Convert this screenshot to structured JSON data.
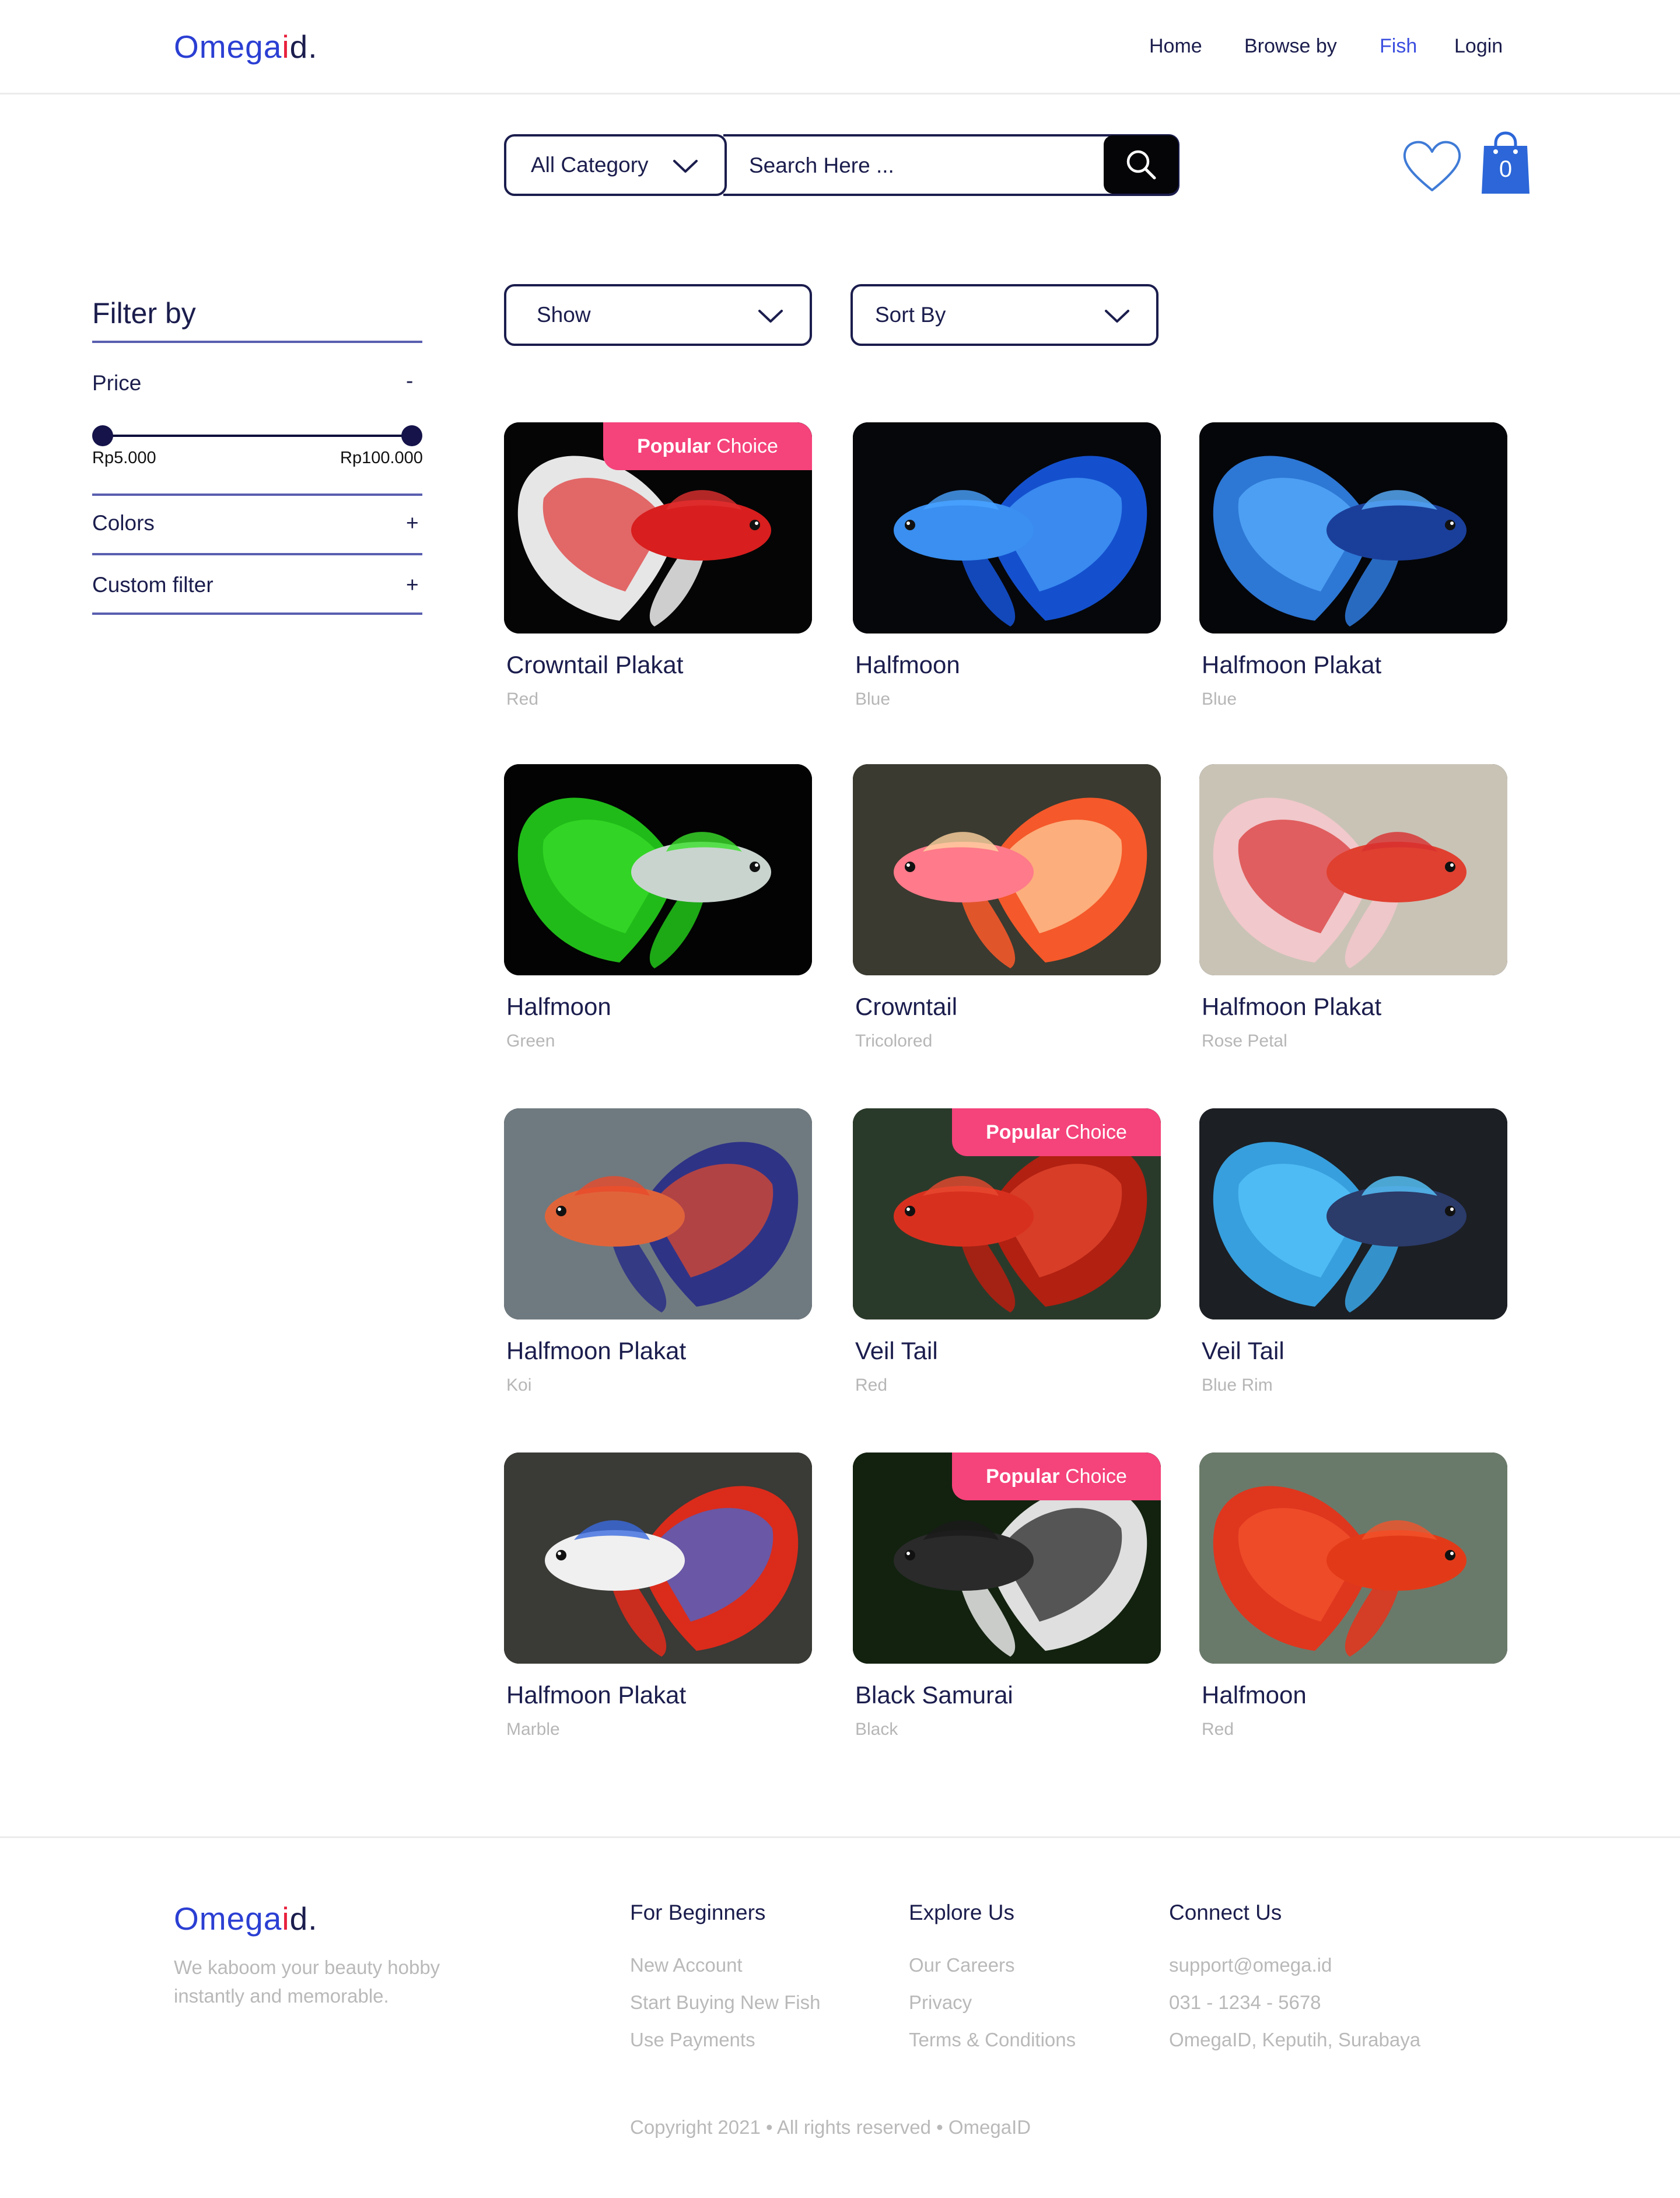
{
  "brand": {
    "part1": "Omega",
    "part2": "i",
    "part3": "d",
    "part4": "."
  },
  "nav": {
    "home": "Home",
    "browse": "Browse by",
    "fish": "Fish",
    "login": "Login"
  },
  "search": {
    "category": "All Category",
    "placeholder": "Search Here ..."
  },
  "cart": {
    "count": "0"
  },
  "filter": {
    "title": "Filter by",
    "price": {
      "label": "Price",
      "toggle": "-",
      "min": "Rp5.000",
      "max": "Rp100.000",
      "range_fraction": [
        0,
        1
      ]
    },
    "colors": {
      "label": "Colors",
      "toggle": "+"
    },
    "custom": {
      "label": "Custom filter",
      "toggle": "+"
    }
  },
  "controls": {
    "show": "Show",
    "sort": "Sort By"
  },
  "badge": {
    "word1": "Popular",
    "word2": " Choice"
  },
  "products": [
    {
      "name": "Crowntail Plakat",
      "variant": "Red",
      "popular": true
    },
    {
      "name": "Halfmoon",
      "variant": "Blue",
      "popular": false
    },
    {
      "name": "Halfmoon Plakat",
      "variant": "Blue",
      "popular": false
    },
    {
      "name": "Halfmoon",
      "variant": "Green",
      "popular": false
    },
    {
      "name": "Crowntail",
      "variant": "Tricolored",
      "popular": false
    },
    {
      "name": "Halfmoon Plakat",
      "variant": "Rose Petal",
      "popular": false
    },
    {
      "name": "Halfmoon Plakat",
      "variant": "Koi",
      "popular": false
    },
    {
      "name": "Veil Tail",
      "variant": "Red",
      "popular": true
    },
    {
      "name": "Veil Tail",
      "variant": "Blue Rim",
      "popular": false
    },
    {
      "name": "Halfmoon Plakat",
      "variant": "Marble",
      "popular": false
    },
    {
      "name": "Black Samurai",
      "variant": "Black",
      "popular": true
    },
    {
      "name": "Halfmoon",
      "variant": "Red",
      "popular": false
    }
  ],
  "footer": {
    "tagline": "We kaboom your beauty hobby instantly and memorable.",
    "beginners": {
      "title": "For Beginners",
      "links": [
        "New Account",
        "Start Buying New Fish",
        "Use Payments"
      ]
    },
    "explore": {
      "title": "Explore Us",
      "links": [
        "Our Careers",
        "Privacy",
        "Terms & Conditions"
      ]
    },
    "connect": {
      "title": "Connect Us",
      "links": [
        "support@omega.id",
        "031 - 1234 - 5678",
        "OmegaID, Keputih, Surabaya"
      ]
    },
    "copyright": "Copyright 2021 • All rights reserved • OmegaID"
  },
  "colors": {
    "brand_blue": "#2b3fd3",
    "brand_red": "#e8203c",
    "navy": "#1b1d4d",
    "badge_pink": "#f5437b",
    "muted": "#b9b9b9"
  }
}
